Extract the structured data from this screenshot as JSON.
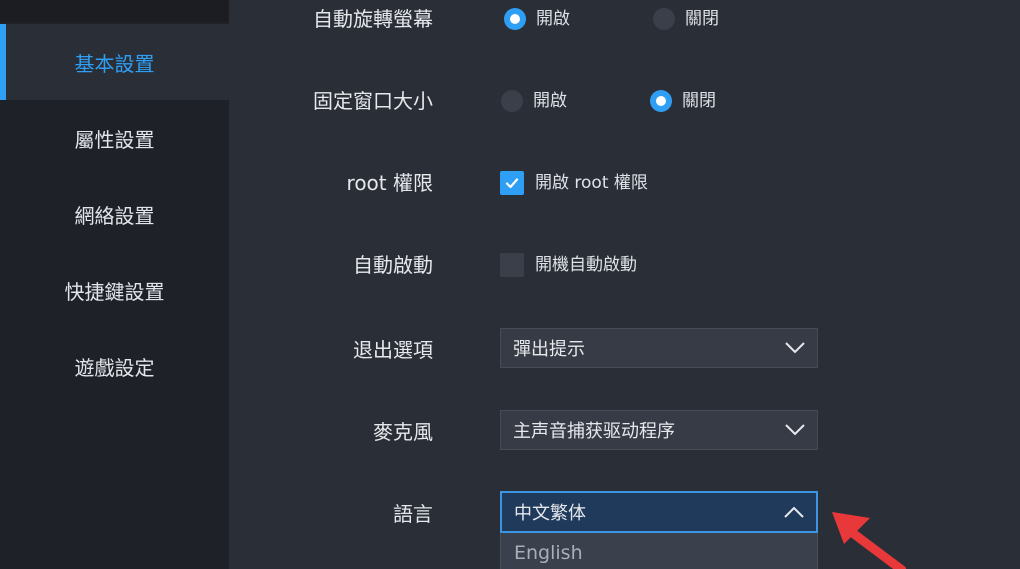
{
  "sidebar": {
    "items": [
      {
        "label": "基本設置",
        "active": true
      },
      {
        "label": "屬性設置",
        "active": false
      },
      {
        "label": "網絡設置",
        "active": false
      },
      {
        "label": "快捷鍵設置",
        "active": false
      },
      {
        "label": "遊戲設定",
        "active": false
      }
    ]
  },
  "settings": {
    "auto_rotate": {
      "label": "自動旋轉螢幕",
      "on_label": "開啟",
      "off_label": "關閉",
      "selected": "on"
    },
    "fixed_window": {
      "label": "固定窗口大小",
      "on_label": "開啟",
      "off_label": "關閉",
      "selected": "off"
    },
    "root": {
      "label": "root 權限",
      "checkbox_label": "開啟 root 權限",
      "checked": true
    },
    "autostart": {
      "label": "自動啟動",
      "checkbox_label": "開機自動啟動",
      "checked": false
    },
    "exit_option": {
      "label": "退出選項",
      "value": "彈出提示"
    },
    "microphone": {
      "label": "麥克風",
      "value": "主声音捕获驱动程序"
    },
    "language": {
      "label": "語言",
      "value": "中文繁体",
      "open": true,
      "options": [
        "English"
      ]
    }
  },
  "colors": {
    "accent": "#2f9ff5",
    "annotation_arrow": "#e8383a"
  }
}
